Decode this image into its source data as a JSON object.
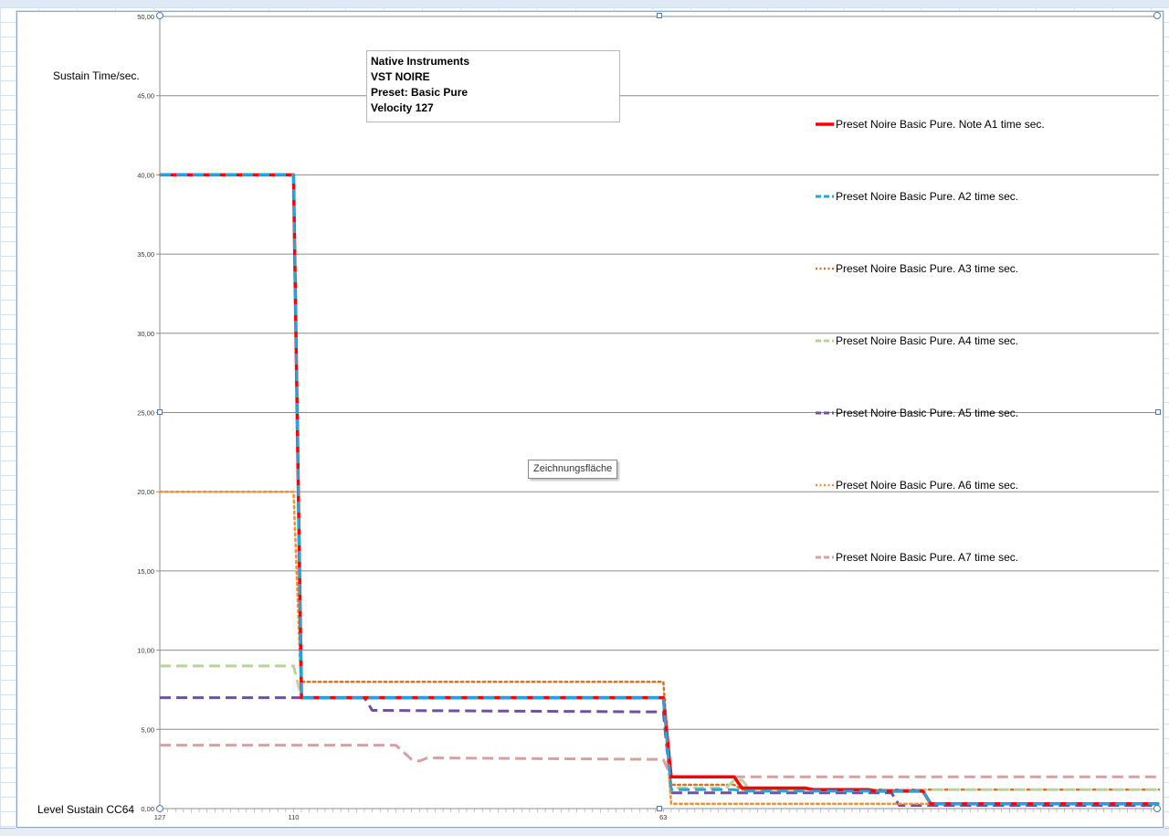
{
  "window": {
    "cell_tooltip": "Zeichnungsfläche"
  },
  "info_box": {
    "line1": "Native Instruments",
    "line2": "VST NOIRE",
    "line3": "Preset: Basic Pure",
    "line4": " Velocity 127"
  },
  "chart_data": {
    "type": "line",
    "title": "",
    "ylabel": "Sustain Time/sec.",
    "xlabel": "Level Sustain CC64",
    "ylim": [
      0,
      50
    ],
    "y_ticks": [
      "0,00",
      "5,00",
      "10,00",
      "15,00",
      "20,00",
      "25,00",
      "30,00",
      "35,00",
      "40,00",
      "45,00",
      "50,00"
    ],
    "x_domain": [
      127,
      0
    ],
    "x_tick_labels": [
      "127",
      "110",
      "63"
    ],
    "x_tick_values": [
      127,
      110,
      63
    ],
    "grid": true,
    "legend_position": "right",
    "series": [
      {
        "name": "Preset Noire Basic Pure.  Note A1 time sec.",
        "color": "#ff0000",
        "dash": "solid",
        "width": 3.5,
        "points": [
          [
            127,
            40
          ],
          [
            110,
            40
          ],
          [
            109,
            7
          ],
          [
            63,
            7
          ],
          [
            62,
            2
          ],
          [
            54,
            2
          ],
          [
            53,
            1.3
          ],
          [
            45,
            1.3
          ],
          [
            44,
            1.2
          ],
          [
            37,
            1.2
          ],
          [
            36,
            1.1
          ],
          [
            30,
            1.1
          ],
          [
            29,
            0.3
          ],
          [
            0,
            0.3
          ]
        ]
      },
      {
        "name": "Preset Noire Basic Pure.  A2 time sec.",
        "color": "#1ea7e0",
        "dash": "dashed",
        "width": 3,
        "points": [
          [
            127,
            40
          ],
          [
            110,
            40
          ],
          [
            109,
            7
          ],
          [
            63,
            7
          ],
          [
            62,
            1.2
          ],
          [
            54,
            1.2
          ],
          [
            53,
            1.1
          ],
          [
            30,
            1.1
          ],
          [
            29,
            0.3
          ],
          [
            0,
            0.3
          ]
        ]
      },
      {
        "name": "Preset Noire Basic Pure.  A3 time sec.",
        "color": "#e07020",
        "dash": "dotted",
        "width": 2.5,
        "points": [
          [
            127,
            40
          ],
          [
            110,
            40
          ],
          [
            109,
            8
          ],
          [
            63,
            8
          ],
          [
            62,
            1.5
          ],
          [
            54,
            1.5
          ],
          [
            53,
            1.2
          ],
          [
            0,
            1.2
          ]
        ]
      },
      {
        "name": "Preset Noire Basic Pure.  A4 time sec.",
        "color": "#b8d49a",
        "dash": "dashed",
        "width": 3,
        "points": [
          [
            127,
            9
          ],
          [
            110,
            9
          ],
          [
            109,
            7
          ],
          [
            63,
            7
          ],
          [
            62,
            1.3
          ],
          [
            55,
            1.3
          ],
          [
            54,
            1.8
          ],
          [
            53,
            1.8
          ],
          [
            52,
            1.2
          ],
          [
            0,
            1.2
          ]
        ]
      },
      {
        "name": "Preset Noire Basic Pure.  A5 time sec.",
        "color": "#7050a0",
        "dash": "dashed",
        "width": 3,
        "points": [
          [
            127,
            7
          ],
          [
            110,
            7
          ],
          [
            101,
            7
          ],
          [
            100,
            6.2
          ],
          [
            63,
            6.1
          ],
          [
            62,
            1.0
          ],
          [
            34,
            1.0
          ],
          [
            33,
            0.2
          ],
          [
            0,
            0.2
          ]
        ]
      },
      {
        "name": "Preset Noire Basic Pure.  A6 time sec.",
        "color": "#f39030",
        "dash": "dotted",
        "width": 2.5,
        "points": [
          [
            127,
            20
          ],
          [
            110,
            20
          ],
          [
            109,
            7
          ],
          [
            63,
            7
          ],
          [
            62,
            0.3
          ],
          [
            0,
            0.3
          ]
        ]
      },
      {
        "name": "Preset Noire Basic Pure.  A7 time sec.",
        "color": "#d8a0a4",
        "dash": "dashed",
        "width": 3,
        "points": [
          [
            127,
            4
          ],
          [
            97,
            4
          ],
          [
            95,
            3.1
          ],
          [
            94,
            3
          ],
          [
            93,
            3.2
          ],
          [
            63,
            3.1
          ],
          [
            62,
            2
          ],
          [
            0,
            2
          ]
        ]
      }
    ]
  }
}
